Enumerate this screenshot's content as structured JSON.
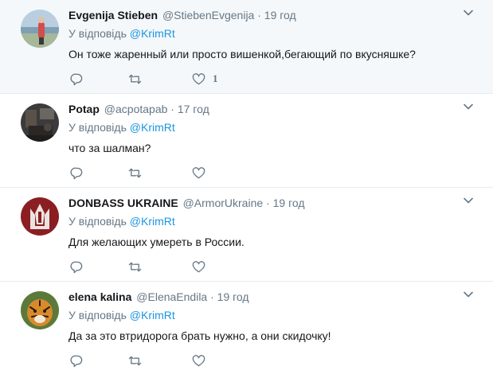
{
  "tweets": [
    {
      "fullname": "Evgenija Stieben",
      "handle": "@StiebenEvgenija",
      "sep": "·",
      "time": "19 год",
      "reply_prefix": "У відповідь",
      "reply_to": "@KrimRt",
      "text": "Он тоже жаренный или просто вишенкой,бегающий по вкусняшке?",
      "like_count": "1",
      "highlighted": true,
      "avatar": "photo-person-seaside"
    },
    {
      "fullname": "Potap",
      "handle": "@acpotapab",
      "sep": "·",
      "time": "17 год",
      "reply_prefix": "У відповідь",
      "reply_to": "@KrimRt",
      "text": "что за шалман?",
      "like_count": "",
      "highlighted": false,
      "avatar": "photo-dark-room"
    },
    {
      "fullname": "DONBASS UKRAINE",
      "handle": "@ArmorUkraine",
      "sep": "·",
      "time": "19 год",
      "reply_prefix": "У відповідь",
      "reply_to": "@KrimRt",
      "text": "Для  желающих  умереть  в  России.",
      "like_count": "",
      "highlighted": false,
      "avatar": "trident-emblem"
    },
    {
      "fullname": "elena kalina",
      "handle": "@ElenaEndila",
      "sep": "·",
      "time": "19 год",
      "reply_prefix": "У відповідь",
      "reply_to": "@KrimRt",
      "text": "Да за это втридорога брать нужно, а они скидочку!",
      "like_count": "",
      "highlighted": false,
      "avatar": "photo-tiger"
    }
  ],
  "icons": {
    "reply": "reply-icon",
    "retweet": "retweet-icon",
    "like": "heart-icon",
    "more": "chevron-down-icon"
  },
  "colors": {
    "link": "#1b95e0",
    "muted": "#657786",
    "highlight_bg": "#f5f8fa",
    "divider": "#e6ecf0"
  }
}
